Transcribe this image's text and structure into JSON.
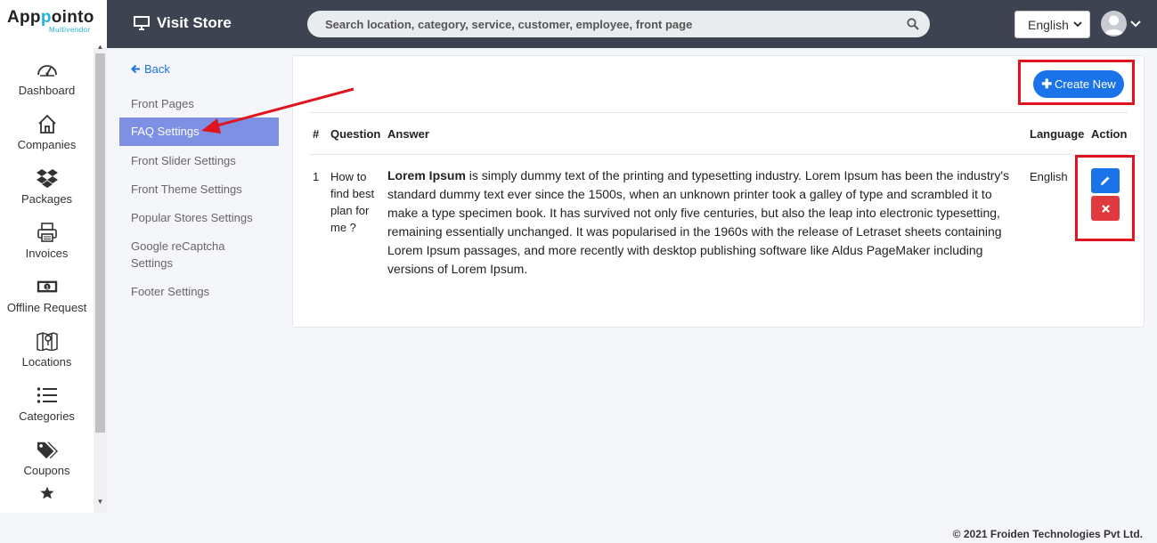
{
  "brand": {
    "name_part1": "App",
    "name_part2": "ointo",
    "name_accent": "p",
    "subtitle": "Multivendor"
  },
  "sidebar": {
    "items": [
      {
        "label": "Dashboard",
        "icon": "dashboard-gauge-icon"
      },
      {
        "label": "Companies",
        "icon": "home-icon"
      },
      {
        "label": "Packages",
        "icon": "dropbox-icon"
      },
      {
        "label": "Invoices",
        "icon": "printer-icon"
      },
      {
        "label": "Offline Request",
        "icon": "money-bill-icon"
      },
      {
        "label": "Locations",
        "icon": "map-icon"
      },
      {
        "label": "Categories",
        "icon": "list-icon"
      },
      {
        "label": "Coupons",
        "icon": "tags-icon"
      },
      {
        "label": "",
        "icon": "star-icon"
      }
    ]
  },
  "header": {
    "visit_store": "Visit Store",
    "search_placeholder": "Search location, category, service, customer, employee, front page",
    "language": "English"
  },
  "subnav": {
    "back": "Back",
    "items": [
      "Front Pages",
      "FAQ Settings",
      "Front Slider Settings",
      "Front Theme Settings",
      "Popular Stores Settings",
      "Google reCaptcha Settings",
      "Footer Settings"
    ],
    "active": "FAQ Settings"
  },
  "main": {
    "create_new": "Create New",
    "columns": [
      "#",
      "Question",
      "Answer",
      "Language",
      "Action"
    ],
    "rows": [
      {
        "num": "1",
        "question": "How to find best plan for me ?",
        "answer_bold": "Lorem Ipsum",
        "answer_rest": " is simply dummy text of the printing and typesetting industry. Lorem Ipsum has been the industry's standard dummy text ever since the 1500s, when an unknown printer took a galley of type and scrambled it to make a type specimen book. It has survived not only five centuries, but also the leap into electronic typesetting, remaining essentially unchanged. It was popularised in the 1960s with the release of Letraset sheets containing Lorem Ipsum passages, and more recently with desktop publishing software like Aldus PageMaker including versions of Lorem Ipsum.",
        "language": "English"
      }
    ]
  },
  "footer": {
    "copyright": "© 2021 Froiden Technologies Pvt Ltd."
  },
  "colors": {
    "header_bg": "#3d4351",
    "primary": "#1a73e8",
    "danger": "#e03a3e",
    "active_nav": "#7d90e3",
    "annotation_red": "#e0141e",
    "brand_accent": "#1fb3d6"
  }
}
